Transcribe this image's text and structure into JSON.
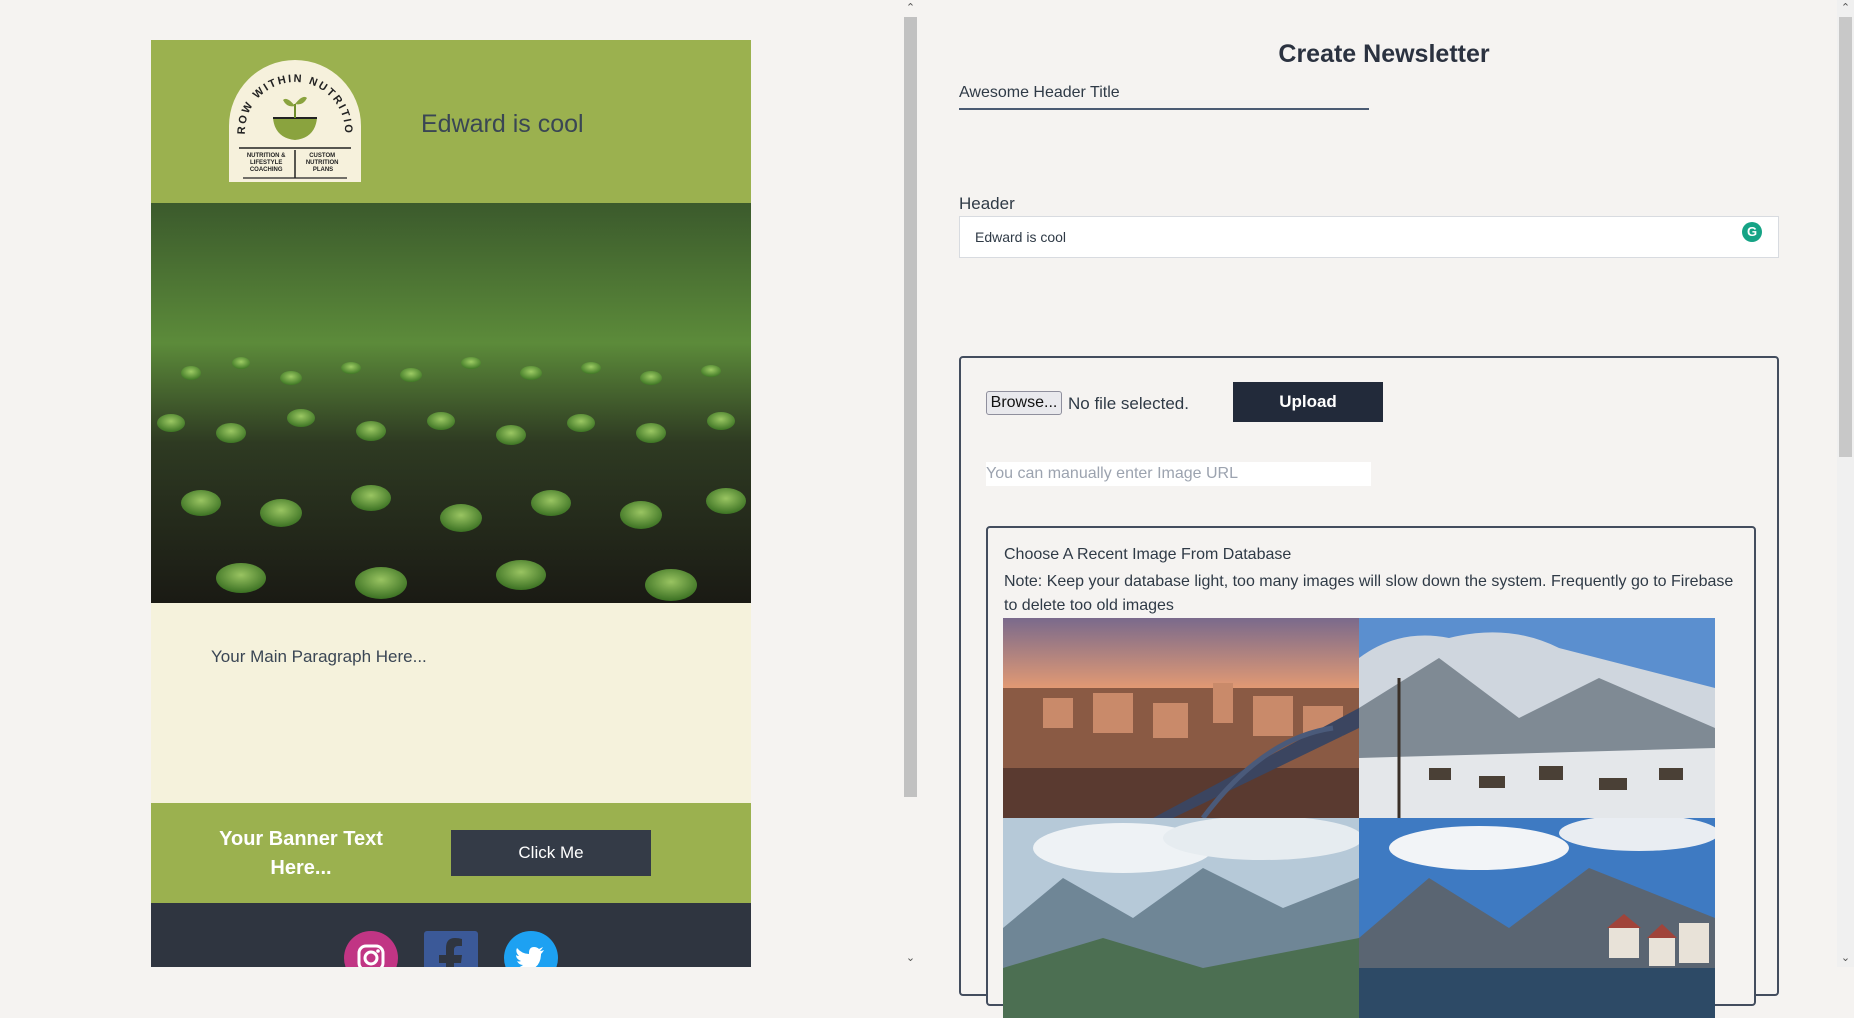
{
  "preview": {
    "header_title": "Edward is cool",
    "logo": {
      "arc_text": "GROW WITHIN NUTRITION",
      "left_caption": [
        "NUTRITION &",
        "LIFESTYLE",
        "COACHING"
      ],
      "right_caption": [
        "CUSTOM",
        "NUTRITION",
        "PLANS"
      ]
    },
    "paragraph": "Your Main Paragraph Here...",
    "banner_text_line1": "Your Banner Text",
    "banner_text_line2": "Here...",
    "banner_button": "Click Me",
    "social_icons": [
      "instagram-icon",
      "facebook-icon",
      "twitter-icon"
    ]
  },
  "form": {
    "title": "Create Newsletter",
    "header_title_value": "Awesome Header Title",
    "header_label": "Header",
    "header_value": "Edward is cool",
    "browse_label": "Browse...",
    "file_status": "No file selected.",
    "upload_label": "Upload",
    "url_placeholder": "You can manually enter Image URL",
    "gallery_heading": "Choose A Recent Image From Database",
    "gallery_note": "Note: Keep your database light, too many images will slow down the system. Frequently go to Firebase to delete too old images"
  },
  "colors": {
    "brand_green": "#9bb14f",
    "cream": "#f5f2dc",
    "dark": "#2f3540",
    "button_dark": "#222a3a"
  }
}
